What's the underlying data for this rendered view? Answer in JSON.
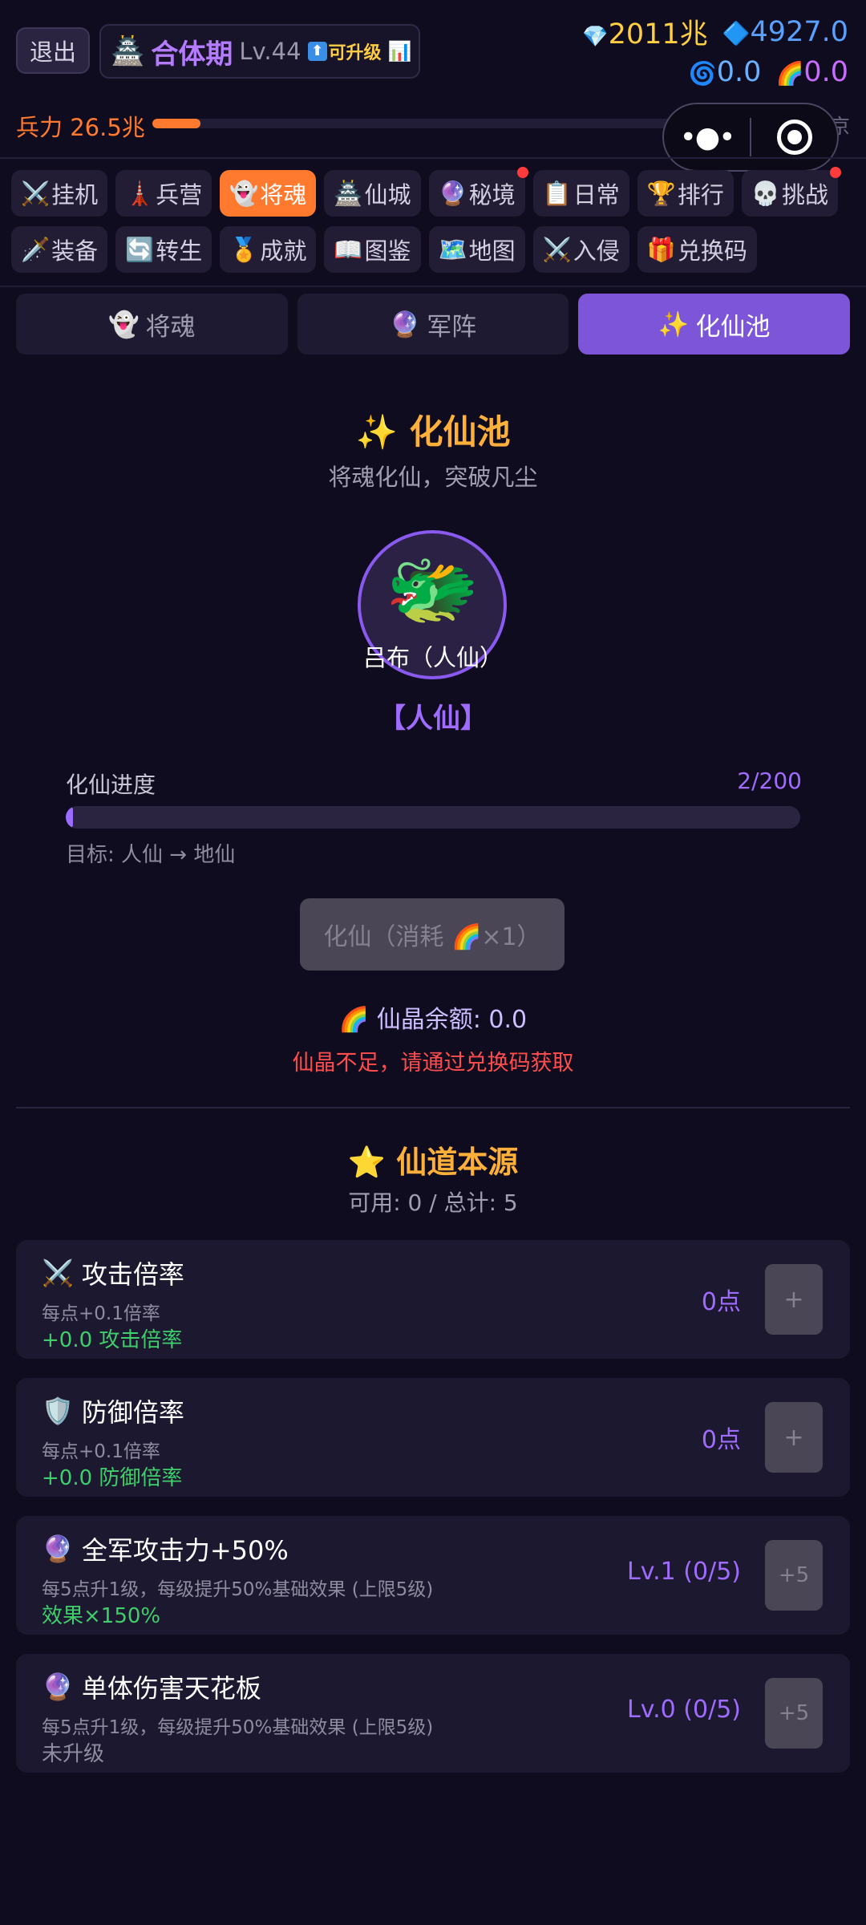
{
  "header": {
    "exit_label": "退出",
    "rank_icon": "🏯",
    "rank_name": "合体期",
    "rank_level": "Lv.44",
    "upgrade_arrow": "⬆",
    "upgrade_label": "可升级",
    "chart_icon": "📊",
    "diamond_icon": "💎",
    "diamond_value": "2011兆",
    "crystal_icon": "🔷",
    "crystal_value": "4927.0",
    "swirl_icon": "🌀",
    "swirl_value": "0.0",
    "rainbow_icon": "🌈",
    "rainbow_value": "0.0",
    "power_label": "兵力 26.5兆",
    "power_max": "15京",
    "power_progress_percent": 7,
    "capsule_more": "•●•"
  },
  "nav_row1": [
    {
      "icon": "⚔️",
      "label": "挂机",
      "active": false,
      "dot": false
    },
    {
      "icon": "🗼",
      "label": "兵营",
      "active": false,
      "dot": false
    },
    {
      "icon": "👻",
      "label": "将魂",
      "active": true,
      "dot": false
    },
    {
      "icon": "🏯",
      "label": "仙城",
      "active": false,
      "dot": false
    },
    {
      "icon": "🔮",
      "label": "秘境",
      "active": false,
      "dot": true
    },
    {
      "icon": "📋",
      "label": "日常",
      "active": false,
      "dot": false
    },
    {
      "icon": "🏆",
      "label": "排行",
      "active": false,
      "dot": false
    },
    {
      "icon": "💀",
      "label": "挑战",
      "active": false,
      "dot": true
    }
  ],
  "nav_row2": [
    {
      "icon": "🗡️",
      "label": "装备"
    },
    {
      "icon": "🔄",
      "label": "转生"
    },
    {
      "icon": "🏅",
      "label": "成就"
    },
    {
      "icon": "📖",
      "label": "图鉴"
    },
    {
      "icon": "🗺️",
      "label": "地图"
    },
    {
      "icon": "⚔️",
      "label": "入侵"
    },
    {
      "icon": "🎁",
      "label": "兑换码"
    }
  ],
  "sub_tabs": [
    {
      "icon": "👻",
      "label": "将魂"
    },
    {
      "icon": "🔮",
      "label": "军阵"
    },
    {
      "icon": "✨",
      "label": "化仙池"
    }
  ],
  "pool": {
    "title": "✨ 化仙池",
    "subtitle": "将魂化仙，突破凡尘",
    "hero_emoji": "🐲",
    "hero_name": "吕布（人仙）",
    "hero_tier": "【人仙】",
    "progress_label": "化仙进度",
    "progress_count": "2/200",
    "progress_fraction": 0.01,
    "progress_target": "目标: 人仙 → 地仙",
    "evolve_label": "化仙（消耗 🌈×1）",
    "balance": "🌈 仙晶余额: 0.0",
    "warning": "仙晶不足，请通过兑换码获取"
  },
  "origin": {
    "title": "⭐ 仙道本源",
    "subtitle": "可用: 0 / 总计: 5"
  },
  "cards": [
    {
      "icon": "⚔️",
      "title": "攻击倍率",
      "desc": "每点+0.1倍率",
      "effect": "+0.0 攻击倍率",
      "value": "0点",
      "button": "+"
    },
    {
      "icon": "🛡️",
      "title": "防御倍率",
      "desc": "每点+0.1倍率",
      "effect": "+0.0 防御倍率",
      "value": "0点",
      "button": "+"
    },
    {
      "icon": "🔮",
      "title": "全军攻击力+50%",
      "desc": "每5点升1级，每级提升50%基础效果 (上限5级)",
      "effect": "效果×150%",
      "value": "Lv.1 (0/5)",
      "button": "+5"
    },
    {
      "icon": "🔮",
      "title": "单体伤害天花板",
      "desc": "每5点升1级，每级提升50%基础效果 (上限5级)",
      "effect": "未升级",
      "value": "Lv.0 (0/5)",
      "button": "+5"
    }
  ],
  "colors": {
    "background": "#100c1f",
    "accent_orange": "#ff7a2e",
    "accent_purple": "#7c55d8",
    "gold": "#ffcf3f",
    "green": "#3ecf6a",
    "warning_red": "#ff4d4d"
  }
}
